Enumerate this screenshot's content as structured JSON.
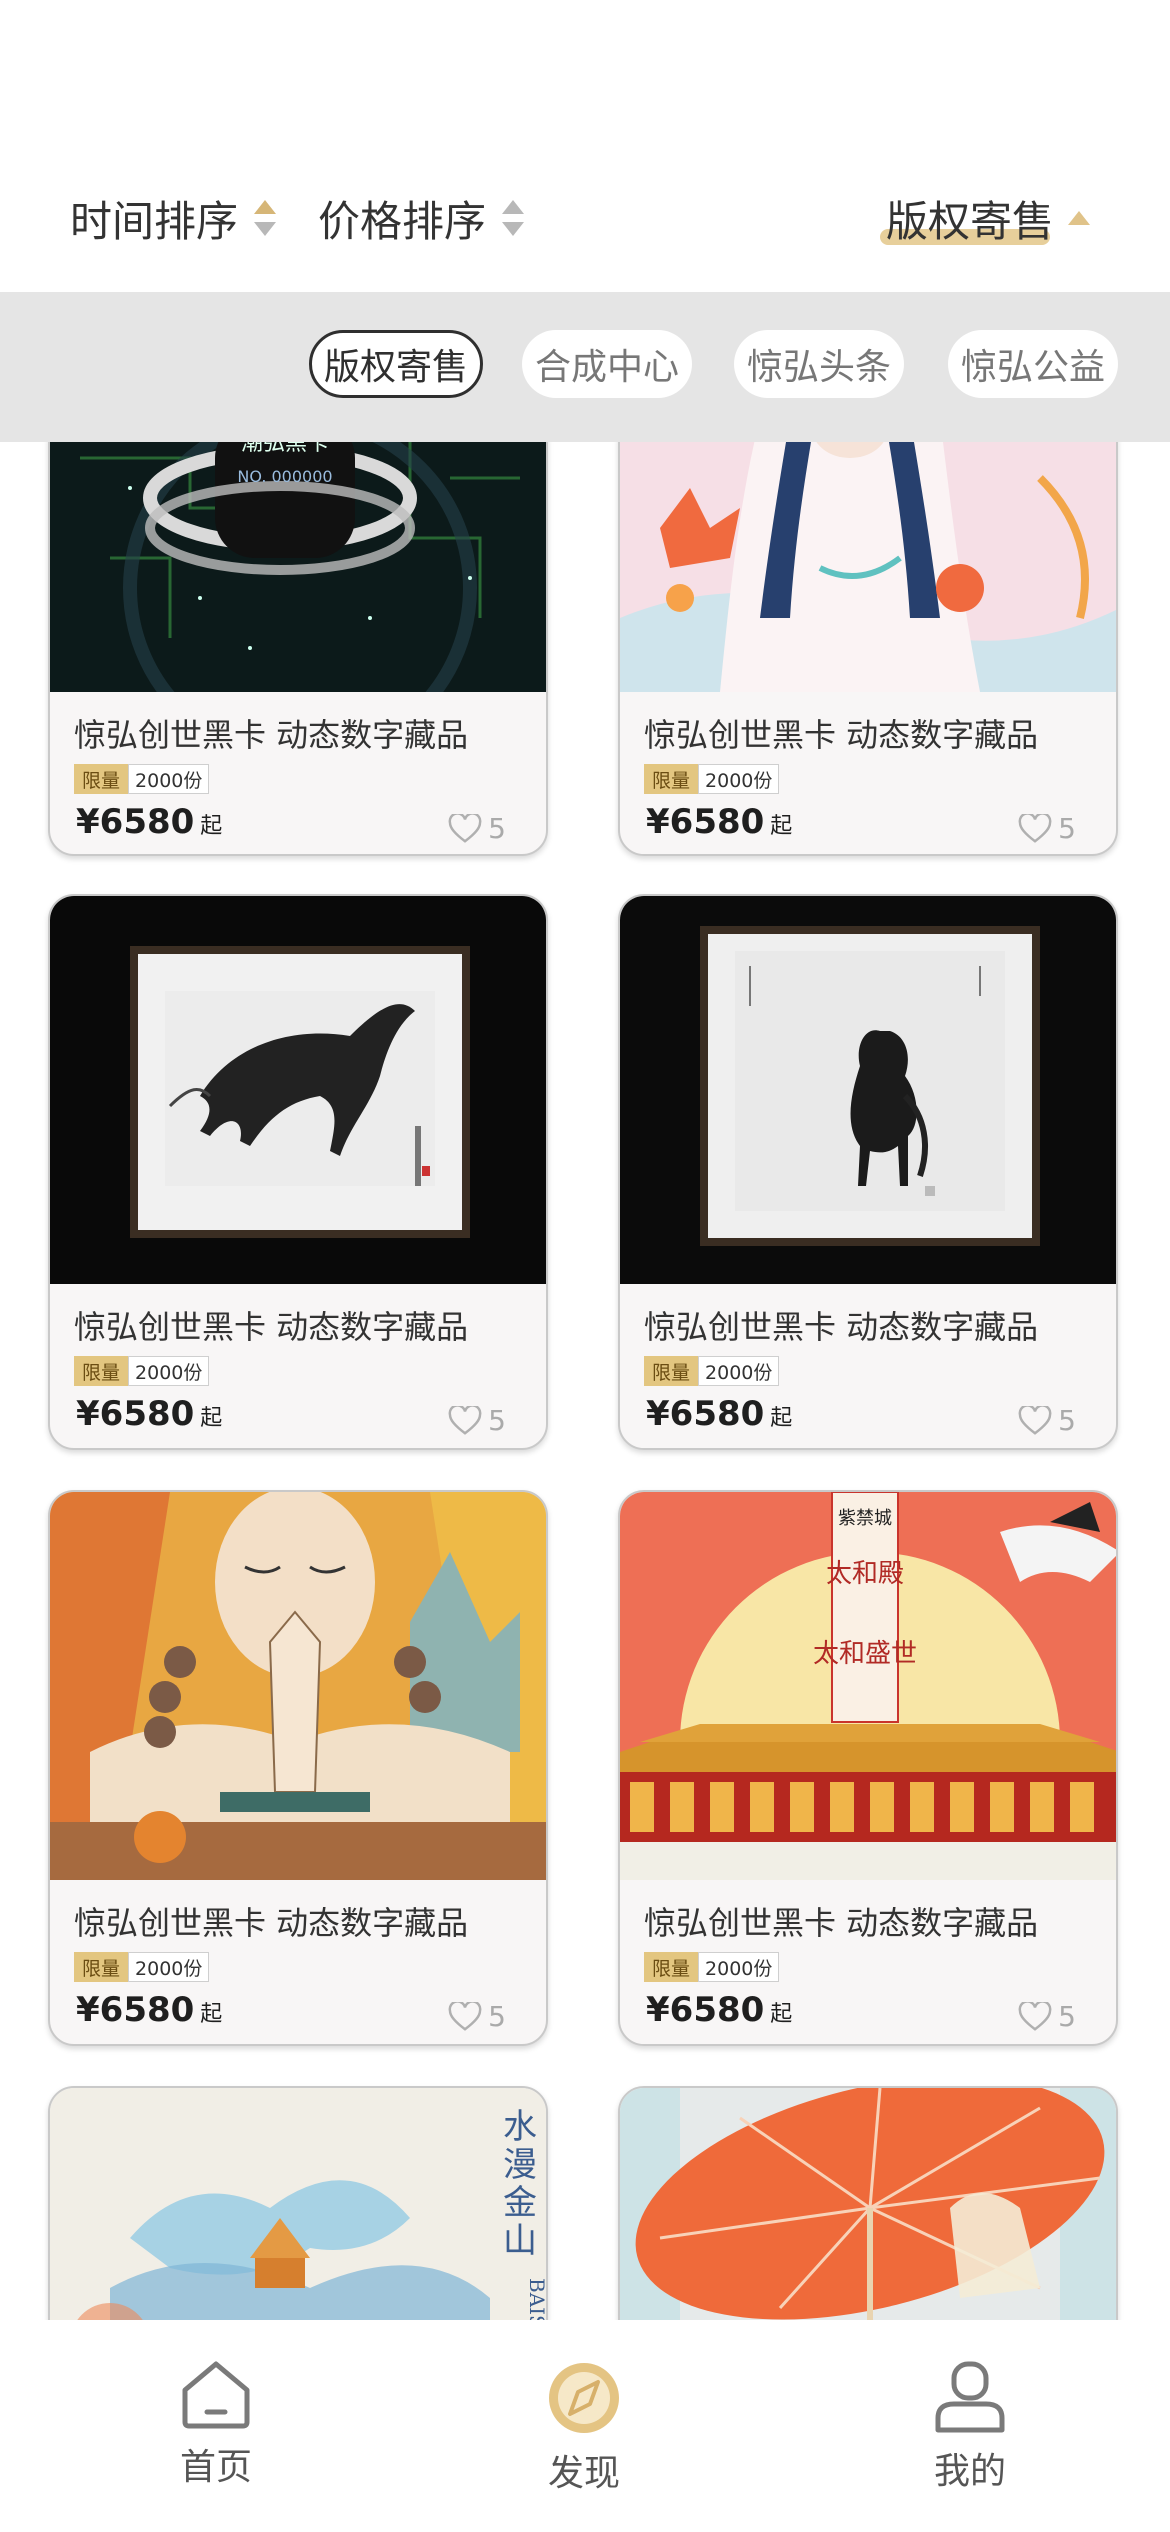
{
  "sort": {
    "time_label": "时间排序",
    "price_label": "价格排序",
    "copyright_label": "版权寄售"
  },
  "categories": [
    {
      "label": "版权寄售",
      "active": true
    },
    {
      "label": "合成中心",
      "active": false
    },
    {
      "label": "惊弘头条",
      "active": false
    },
    {
      "label": "惊弘公益",
      "active": false
    }
  ],
  "products": [
    {
      "title": "惊弘创世黑卡 动态数字藏品",
      "limit_label": "限量",
      "limit_count": "2000份",
      "price": "¥6580",
      "price_suffix": "起",
      "likes": "5",
      "image": "saturn-black-card",
      "card_text": "潮弘黑卡",
      "card_no": "NO. 000000"
    },
    {
      "title": "惊弘创世黑卡 动态数字藏品",
      "limit_label": "限量",
      "limit_count": "2000份",
      "price": "¥6580",
      "price_suffix": "起",
      "likes": "5",
      "image": "goddess-lotus"
    },
    {
      "title": "惊弘创世黑卡 动态数字藏品",
      "limit_label": "限量",
      "limit_count": "2000份",
      "price": "¥6580",
      "price_suffix": "起",
      "likes": "5",
      "image": "galloping-horse-painting"
    },
    {
      "title": "惊弘创世黑卡 动态数字藏品",
      "limit_label": "限量",
      "limit_count": "2000份",
      "price": "¥6580",
      "price_suffix": "起",
      "likes": "5",
      "image": "standing-horse-painting"
    },
    {
      "title": "惊弘创世黑卡 动态数字藏品",
      "limit_label": "限量",
      "limit_count": "2000份",
      "price": "¥6580",
      "price_suffix": "起",
      "likes": "5",
      "image": "praying-monk"
    },
    {
      "title": "惊弘创世黑卡 动态数字藏品",
      "limit_label": "限量",
      "limit_count": "2000份",
      "price": "¥6580",
      "price_suffix": "起",
      "likes": "5",
      "image": "forbidden-city-palace",
      "banner_text": "紫禁城 太和殿·太和盛世"
    },
    {
      "image": "water-golden-mountain",
      "banner_text": "水漫金山 BAISH"
    },
    {
      "image": "oil-paper-umbrella"
    }
  ],
  "tabs": [
    {
      "label": "首页",
      "icon": "home-icon",
      "active": false
    },
    {
      "label": "发现",
      "icon": "compass-icon",
      "active": true
    },
    {
      "label": "我的",
      "icon": "user-icon",
      "active": false
    }
  ],
  "colors": {
    "accent": "#e3c680",
    "tab_bg": "#e5e5e5",
    "card_bg": "#f8f6f6"
  }
}
